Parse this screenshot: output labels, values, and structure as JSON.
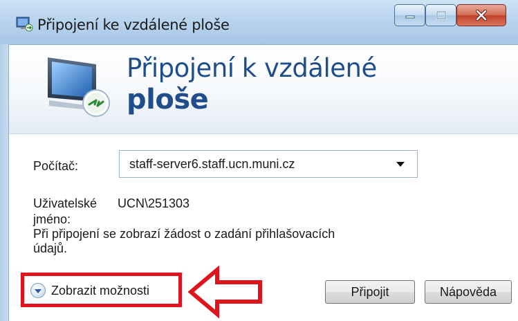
{
  "window": {
    "title": "Připojení ke vzdálené ploše",
    "icons": {
      "app": "remote-desktop-icon",
      "minimize": "minimize-icon",
      "maximize": "maximize-icon",
      "close": "close-icon"
    }
  },
  "banner": {
    "title_line1": "Připojení k vzdálené",
    "title_line2": "ploše",
    "icon": "remote-desktop-monitor-icon"
  },
  "form": {
    "computer_label": "Počítač:",
    "computer_value": "staff-server6.staff.ucn.muni.cz",
    "username_label_line1": "Uživatelské",
    "username_label_line2": "jméno:",
    "username_value": "UCN\\251303",
    "notice_line1": "Při připojení se zobrazí žádost o zadání přihlašovacích",
    "notice_line2": "údajů."
  },
  "footer": {
    "show_options_label": "Zobrazit možnosti",
    "connect_label": "Připojit",
    "help_label": "Nápověda"
  },
  "annotation": {
    "highlight_color": "#e0141c",
    "arrow_icon": "left-arrow-outline-icon"
  }
}
